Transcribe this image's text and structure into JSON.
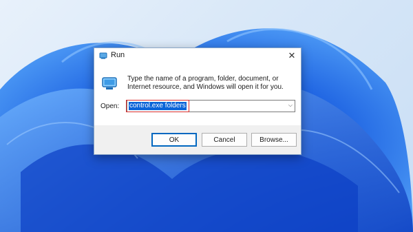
{
  "dialog": {
    "title": "Run",
    "close_glyph": "✕",
    "description": "Type the name of a program, folder, document, or Internet resource, and Windows will open it for you.",
    "open_label": "Open:",
    "open_value": "control.exe folders",
    "dropdown_glyph": "⌵",
    "buttons": {
      "ok": "OK",
      "cancel": "Cancel",
      "browse": "Browse..."
    }
  },
  "icons": {
    "title": "run-icon",
    "body": "run-program-icon"
  },
  "colors": {
    "selection": "#0a64d8",
    "highlight_border": "#d62b2b",
    "wallpaper_blue": "#1d5fd6"
  }
}
